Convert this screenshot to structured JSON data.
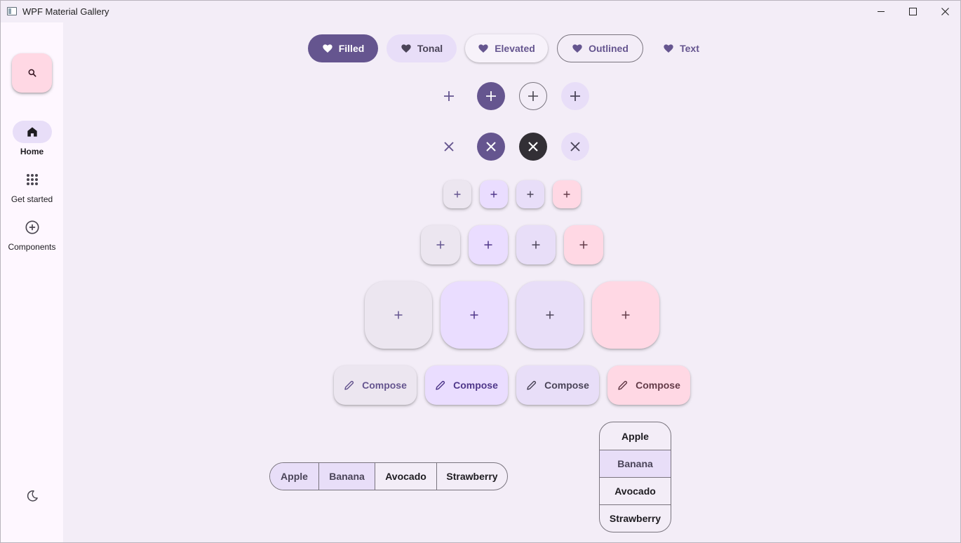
{
  "window": {
    "title": "WPF Material Gallery",
    "minimize_icon": "minimize-icon",
    "maximize_icon": "maximize-icon",
    "close_icon": "close-icon"
  },
  "rail": {
    "search_icon": "search-icon",
    "items": [
      {
        "label": "Home",
        "icon": "home-icon",
        "active": true
      },
      {
        "label": "Get started",
        "icon": "apps-grid-icon",
        "active": false
      },
      {
        "label": "Components",
        "icon": "add-circle-icon",
        "active": false
      }
    ],
    "theme_icon": "moon-icon"
  },
  "buttons": {
    "filled": "Filled",
    "tonal": "Tonal",
    "elevated": "Elevated",
    "outlined": "Outlined",
    "text": "Text",
    "icon": "heart-icon"
  },
  "icon_buttons": {
    "add_row_icon": "add-icon",
    "close_row_icon": "close-icon",
    "variants": [
      "standard",
      "filled",
      "outlined",
      "tonal"
    ]
  },
  "fabs": {
    "icon": "add-icon",
    "colors": [
      "surface",
      "primary",
      "secondary",
      "tertiary"
    ],
    "sizes": [
      "small",
      "medium",
      "large"
    ]
  },
  "extended_fabs": {
    "label": "Compose",
    "icon": "pencil-icon"
  },
  "segmented": {
    "options": [
      "Apple",
      "Banana",
      "Avocado",
      "Strawberry"
    ],
    "selected_horizontal": [
      "Apple",
      "Banana"
    ],
    "selected_vertical": [
      "Banana"
    ]
  },
  "colors": {
    "primary": "#65558f",
    "secondary_container": "#e8def8",
    "primary_container": "#eaddff",
    "tertiary_container": "#ffd8e4",
    "surface_container": "#ece6f0",
    "background": "#f3edf7",
    "rail_background": "#fef7ff"
  }
}
